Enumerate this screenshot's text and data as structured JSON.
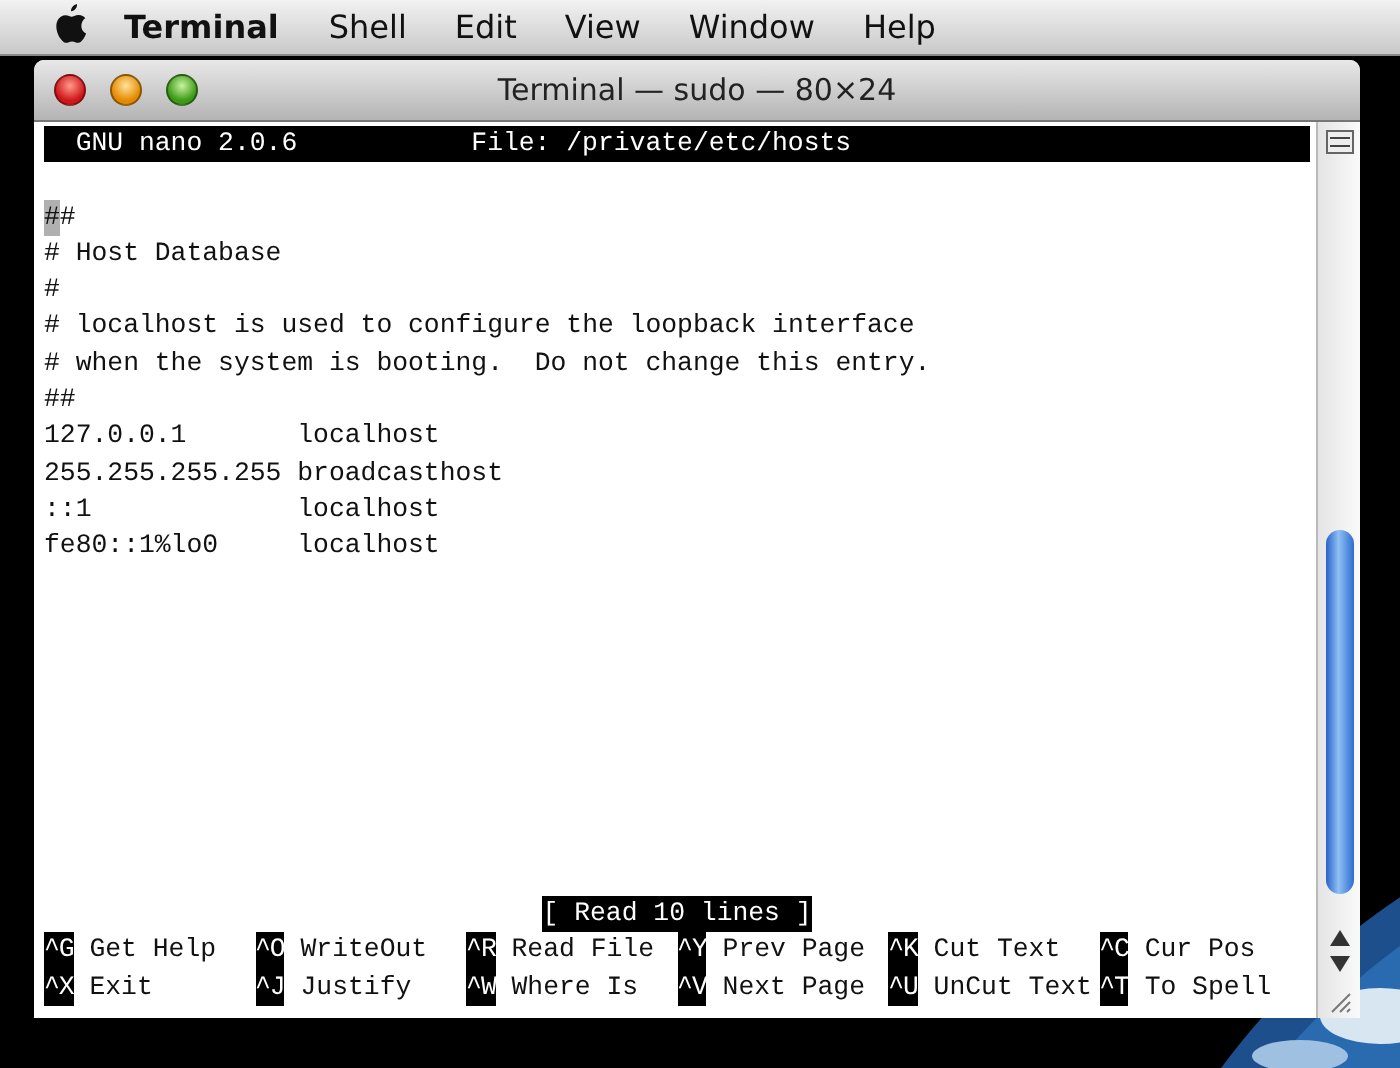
{
  "menubar": {
    "app": "Terminal",
    "items": [
      "Shell",
      "Edit",
      "View",
      "Window",
      "Help"
    ]
  },
  "window": {
    "title": "Terminal — sudo — 80×24"
  },
  "nano": {
    "header": {
      "version": "GNU nano 2.0.6",
      "file": "File: /private/etc/hosts"
    },
    "lines": [
      "##",
      "# Host Database",
      "#",
      "# localhost is used to configure the loopback interface",
      "# when the system is booting.  Do not change this entry.",
      "##",
      "127.0.0.1       localhost",
      "255.255.255.255 broadcasthost",
      "::1             localhost",
      "fe80::1%lo0     localhost"
    ],
    "status": "[ Read 10 lines ]",
    "shortcuts": [
      [
        {
          "key": "^G",
          "label": "Get Help"
        },
        {
          "key": "^O",
          "label": "WriteOut"
        },
        {
          "key": "^R",
          "label": "Read File"
        },
        {
          "key": "^Y",
          "label": "Prev Page"
        },
        {
          "key": "^K",
          "label": "Cut Text"
        },
        {
          "key": "^C",
          "label": "Cur Pos"
        }
      ],
      [
        {
          "key": "^X",
          "label": "Exit"
        },
        {
          "key": "^J",
          "label": "Justify"
        },
        {
          "key": "^W",
          "label": "Where Is"
        },
        {
          "key": "^V",
          "label": "Next Page"
        },
        {
          "key": "^U",
          "label": "UnCut Text"
        },
        {
          "key": "^T",
          "label": "To Spell"
        }
      ]
    ]
  }
}
